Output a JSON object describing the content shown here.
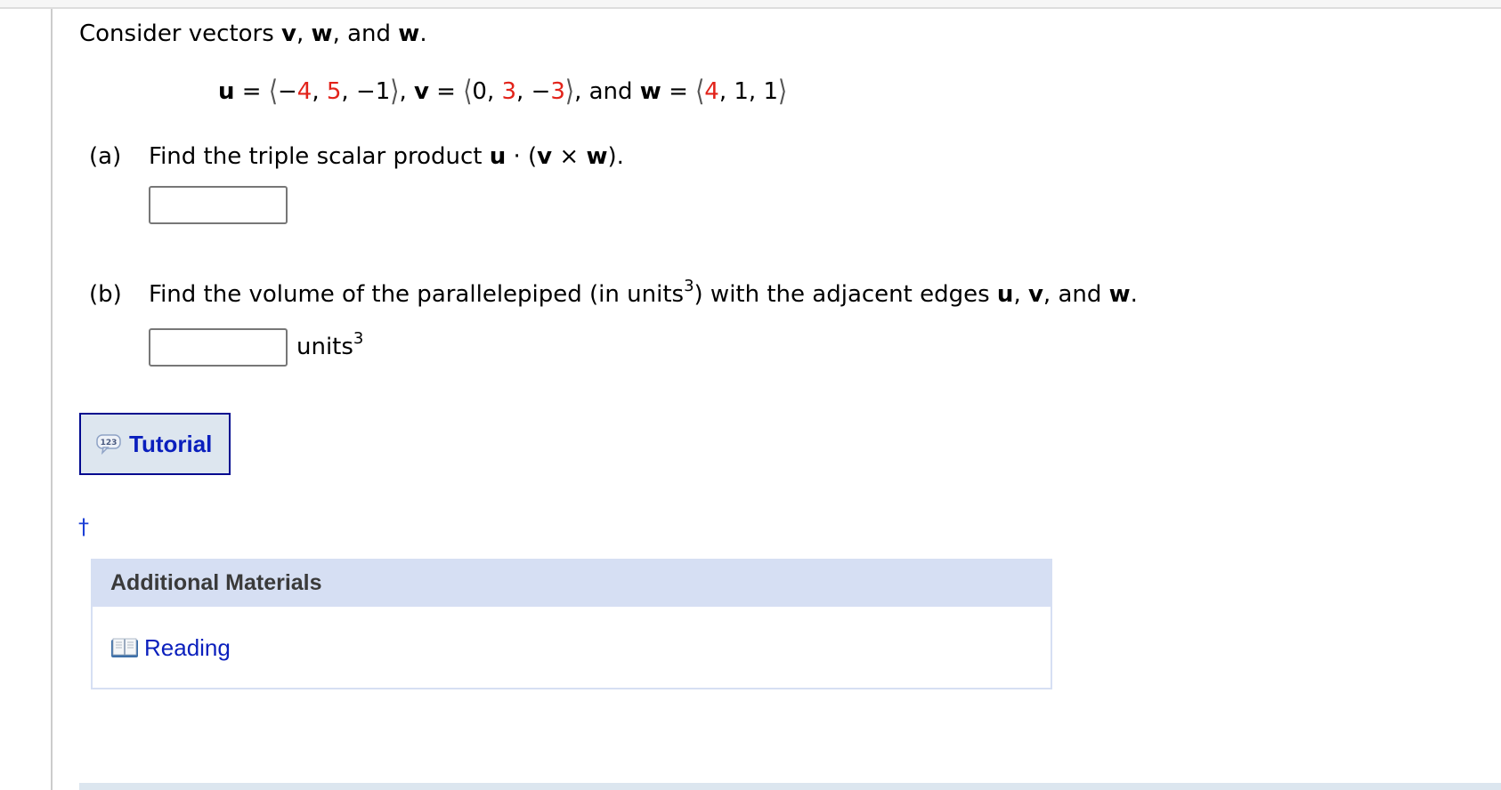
{
  "intro": {
    "prefix": "Consider vectors ",
    "v1": "v",
    "sep1": ", ",
    "v2": "w",
    "sep2": ", and ",
    "v3": "w",
    "end": "."
  },
  "equation": {
    "u_name": "u",
    "u": [
      "−",
      "4",
      "5",
      "−1"
    ],
    "v_name": "v",
    "v": [
      "0",
      "3",
      "−",
      "3"
    ],
    "and": ", and ",
    "w_name": "w",
    "w": [
      "4",
      "1",
      "1"
    ],
    "eq": " = ",
    "comma": ", ",
    "open": "⟨",
    "close": "⟩"
  },
  "part_a": {
    "label": "(a)",
    "text": "Find the triple scalar product ",
    "u": "u",
    "dot": " · (",
    "v": "v",
    "cross": " × ",
    "w": "w",
    "end": ").",
    "answer_value": ""
  },
  "part_b": {
    "label": "(b)",
    "text1": "Find the volume of the parallelepiped (in units",
    "sup": "3",
    "text2": ") with the adjacent edges ",
    "u": "u",
    "sep1": ", ",
    "v": "v",
    "sep2": ", and ",
    "w": "w",
    "end": ".",
    "answer_value": "",
    "units": "units",
    "units_sup": "3"
  },
  "tutorial": {
    "label": "Tutorial",
    "icon": "123-speech-bubble-icon"
  },
  "dagger": "†",
  "additional_materials": {
    "title": "Additional Materials",
    "items": [
      {
        "label": "Reading",
        "icon": "book-icon"
      }
    ]
  },
  "colors": {
    "highlight_red": "#e2231a",
    "link_blue": "#0a1fbd",
    "tutorial_border": "#00098f",
    "panel_header": "#d6dff3"
  }
}
